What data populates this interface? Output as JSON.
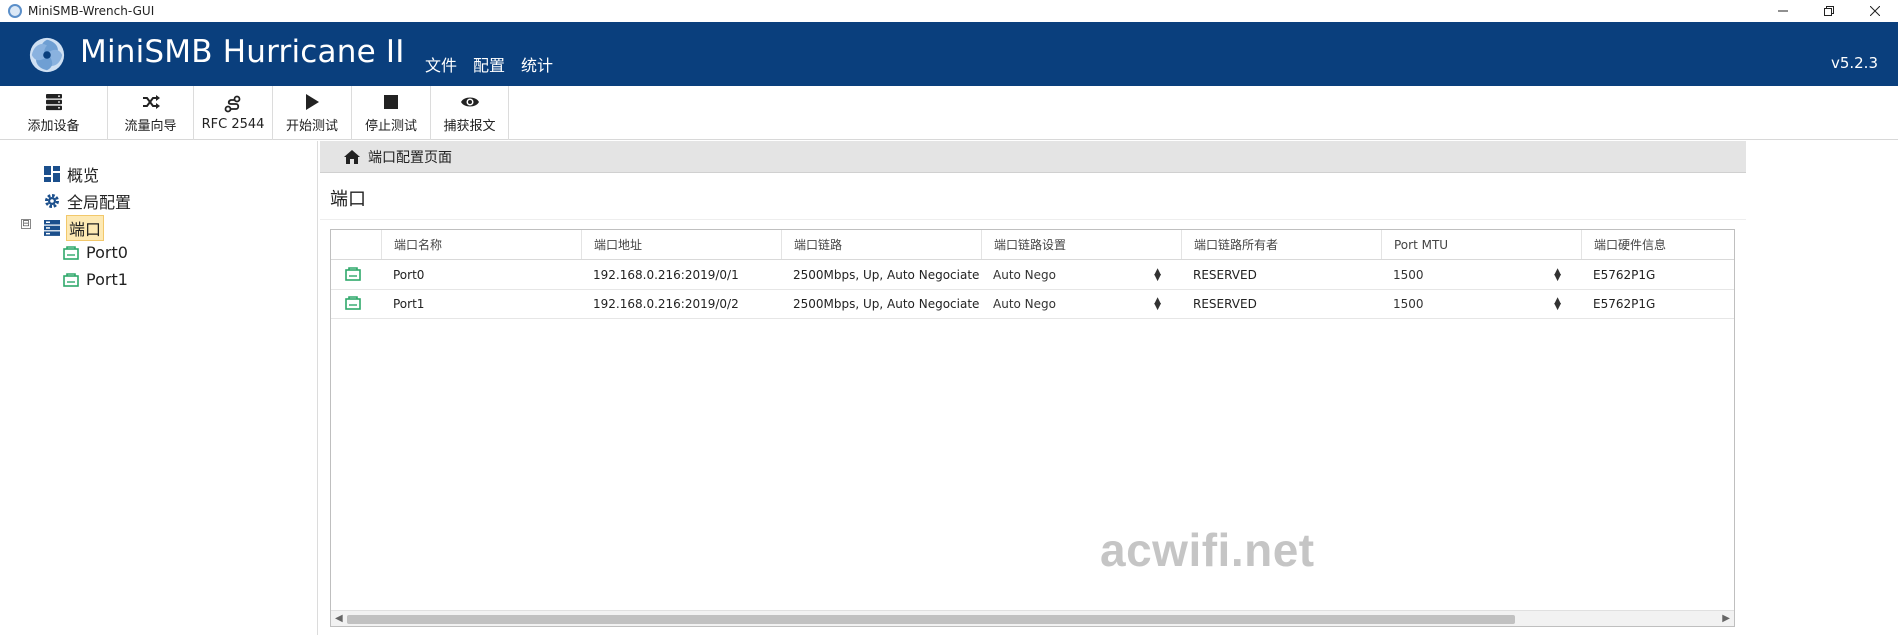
{
  "window": {
    "title": "MiniSMB-Wrench-GUI"
  },
  "header": {
    "title": "MiniSMB Hurricane II",
    "menu": [
      "文件",
      "配置",
      "统计"
    ],
    "version": "v5.2.3",
    "bg_color": "#0a3f7d"
  },
  "toolbar": [
    {
      "label": "添加设备",
      "icon": "server-add-icon"
    },
    {
      "label": "流量向导",
      "icon": "shuffle-icon"
    },
    {
      "label": "RFC 2544",
      "icon": "route-icon"
    },
    {
      "label": "开始测试",
      "icon": "play-icon"
    },
    {
      "label": "停止测试",
      "icon": "stop-icon"
    },
    {
      "label": "捕获报文",
      "icon": "eye-icon"
    }
  ],
  "sidebar": {
    "items": [
      {
        "label": "概览",
        "icon": "dashboard-icon"
      },
      {
        "label": "全局配置",
        "icon": "gear-icon"
      },
      {
        "label": "端口",
        "icon": "server-icon",
        "selected": true,
        "expanded": true
      },
      {
        "label": "Port0",
        "icon": "ethernet-port-icon"
      },
      {
        "label": "Port1",
        "icon": "ethernet-port-icon"
      }
    ],
    "expander": "⊟"
  },
  "breadcrumb": {
    "label": "端口配置页面"
  },
  "page": {
    "title": "端口"
  },
  "table": {
    "columns": [
      "",
      "端口名称",
      "端口地址",
      "端口链路",
      "端口链路设置",
      "端口链路所有者",
      "Port MTU",
      "端口硬件信息"
    ],
    "rows": [
      {
        "name": "Port0",
        "address": "192.168.0.216:2019/0/1",
        "link": "2500Mbps, Up, Auto Negociate",
        "link_setting": "Auto Nego",
        "owner": "RESERVED",
        "mtu": "1500",
        "hardware": "E5762P1G"
      },
      {
        "name": "Port1",
        "address": "192.168.0.216:2019/0/2",
        "link": "2500Mbps, Up, Auto Negociate",
        "link_setting": "Auto Nego",
        "owner": "RESERVED",
        "mtu": "1500",
        "hardware": "E5762P1G"
      }
    ]
  },
  "watermark": "acwifi.net",
  "colors": {
    "port_icon": "#2fa86b",
    "selection": "#fde9b4"
  }
}
